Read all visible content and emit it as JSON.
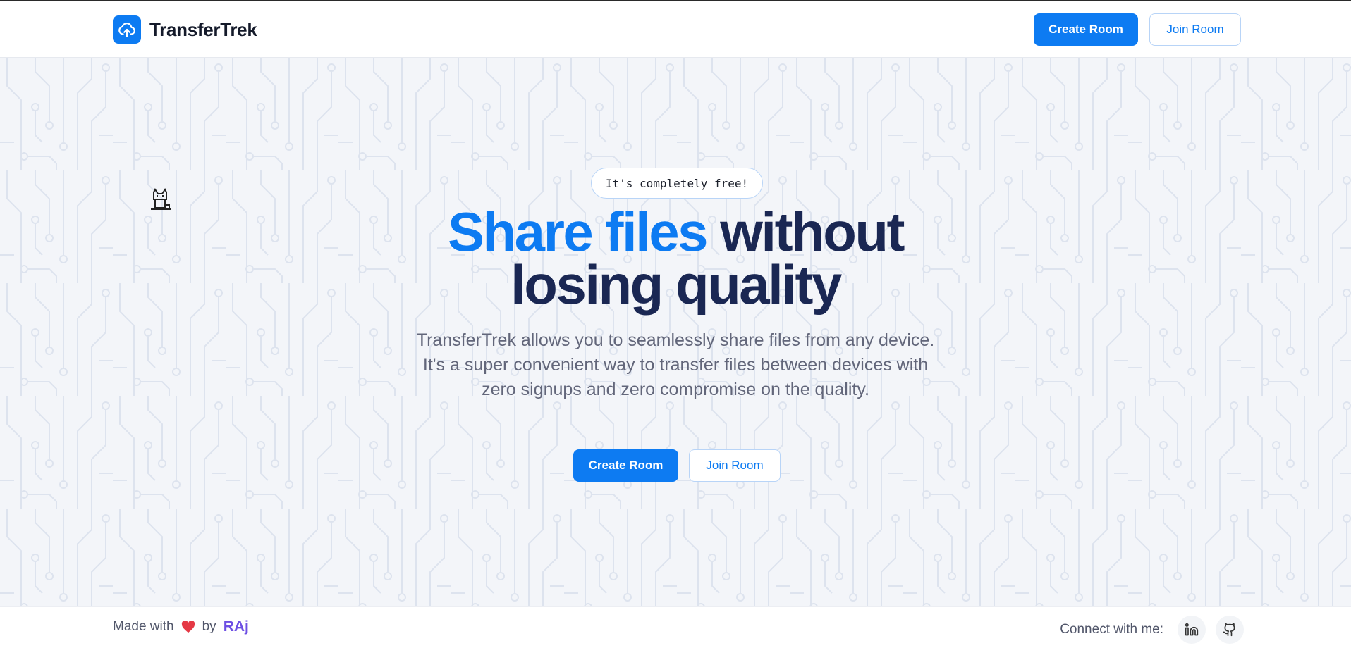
{
  "header": {
    "brand_name": "TransferTrek",
    "create_room_label": "Create Room",
    "join_room_label": "Join Room"
  },
  "hero": {
    "badge": "It's completely free!",
    "headline_accent": "Share files",
    "headline_rest_line1": " without",
    "headline_line2": "losing quality",
    "description": "TransferTrek allows you to seamlessly share files from any device. It's a super convenient way to transfer files between devices with zero signups and zero compromise on the quality.",
    "create_room_label": "Create Room",
    "join_room_label": "Join Room"
  },
  "footer": {
    "made_with": "Made with",
    "by": "by",
    "author": "RAj",
    "connect_label": "Connect with me:",
    "socials": [
      "linkedin-icon",
      "github-icon"
    ]
  },
  "colors": {
    "accent": "#0d7bf2",
    "headline": "#1a2753",
    "heart": "#e53945",
    "author": "#6d4fe3"
  }
}
